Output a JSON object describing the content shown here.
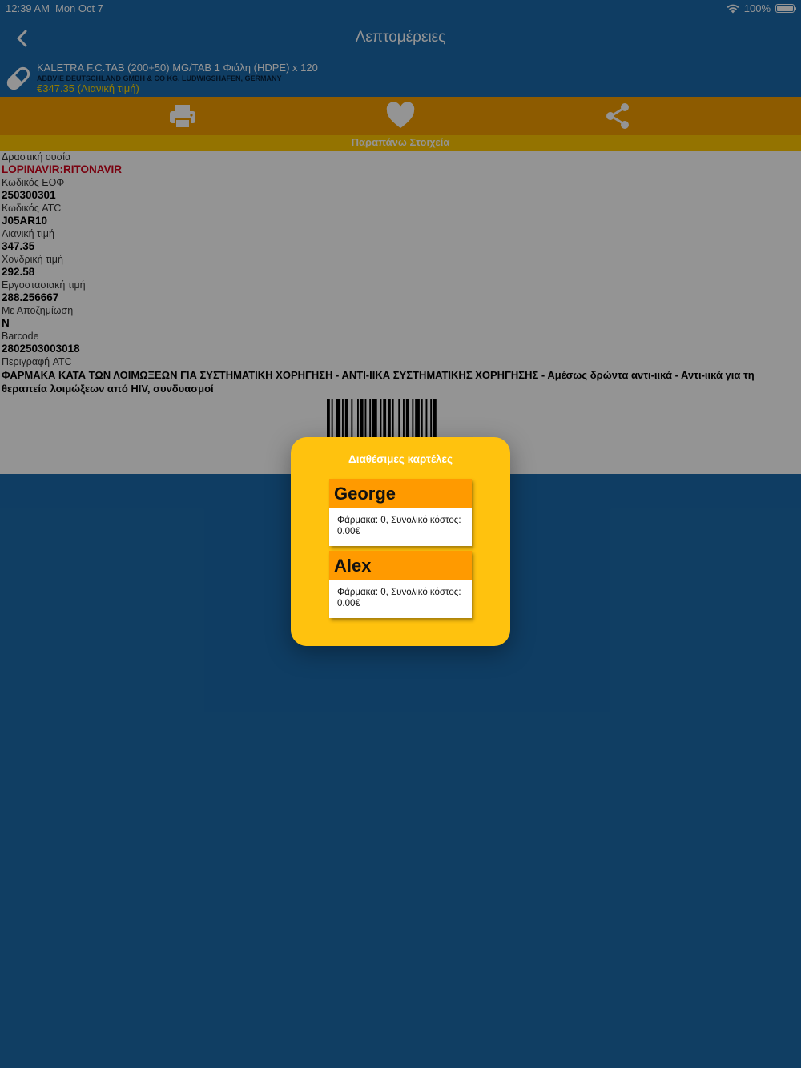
{
  "status_bar": {
    "time": "12:39 AM",
    "date": "Mon Oct 7",
    "battery": "100%"
  },
  "nav": {
    "title": "Λεπτομέρειες"
  },
  "drug": {
    "name": "KALETRA F.C.TAB (200+50) MG/TAB 1 Φιάλη (HDPE) x 120",
    "manufacturer": "ABBVIE DEUTSCHLAND GMBH & CO KG, LUDWIGSHAFEN, GERMANY",
    "price_label": "€347.35 (Λιανική τιμή)"
  },
  "section": {
    "title": "Παραπάνω Στοιχεία"
  },
  "fields": [
    {
      "label": "Δραστική ουσία",
      "value": "LOPINAVIR:RITONAVIR"
    },
    {
      "label": "Κωδικός ΕΟΦ",
      "value": "250300301"
    },
    {
      "label": "Κωδικός ATC",
      "value": "J05AR10"
    },
    {
      "label": "Λιανική τιμή",
      "value": "347.35"
    },
    {
      "label": "Χονδρική τιμή",
      "value": "292.58"
    },
    {
      "label": "Εργοστασιακή τιμή",
      "value": "288.256667"
    },
    {
      "label": "Με Αποζημίωση",
      "value": "N"
    },
    {
      "label": "Barcode",
      "value": "2802503003018"
    },
    {
      "label": "Περιγραφή ATC",
      "value": "ΦΑΡΜΑΚΑ ΚΑΤΑ ΤΩΝ ΛΟΙΜΩΞΕΩΝ ΓΙΑ ΣΥΣΤΗΜΑΤΙΚΗ ΧΟΡΗΓΗΣΗ - ΑΝΤΙ-ΙΙΚΑ ΣΥΣΤΗΜΑΤΙΚΗΣ ΧΟΡΗΓΗΣΗΣ - Αμέσως δρώντα αντι-ιικά - Αντι-ιικά για τη θεραπεία λοιμώξεων από HIV, συνδυασμοί"
    }
  ],
  "modal": {
    "title": "Διαθέσιμες καρτέλες",
    "cards": [
      {
        "name": "George",
        "summary": "Φάρμακα: 0, Συνολικό κόστος: 0.00€"
      },
      {
        "name": "Alex",
        "summary": "Φάρμακα: 0, Συνολικό κόστος: 0.00€"
      }
    ]
  },
  "colors": {
    "app_blue": "#1b6aab",
    "action_orange": "#f39d00",
    "section_yellow": "#ffc600",
    "modal_yellow": "#ffc20e",
    "card_header_orange": "#ff9a00",
    "accent_red": "#d0021b"
  },
  "icons": [
    "back-chevron-icon",
    "pill-icon",
    "printer-icon",
    "heart-icon",
    "share-icon",
    "wifi-icon",
    "battery-icon"
  ]
}
